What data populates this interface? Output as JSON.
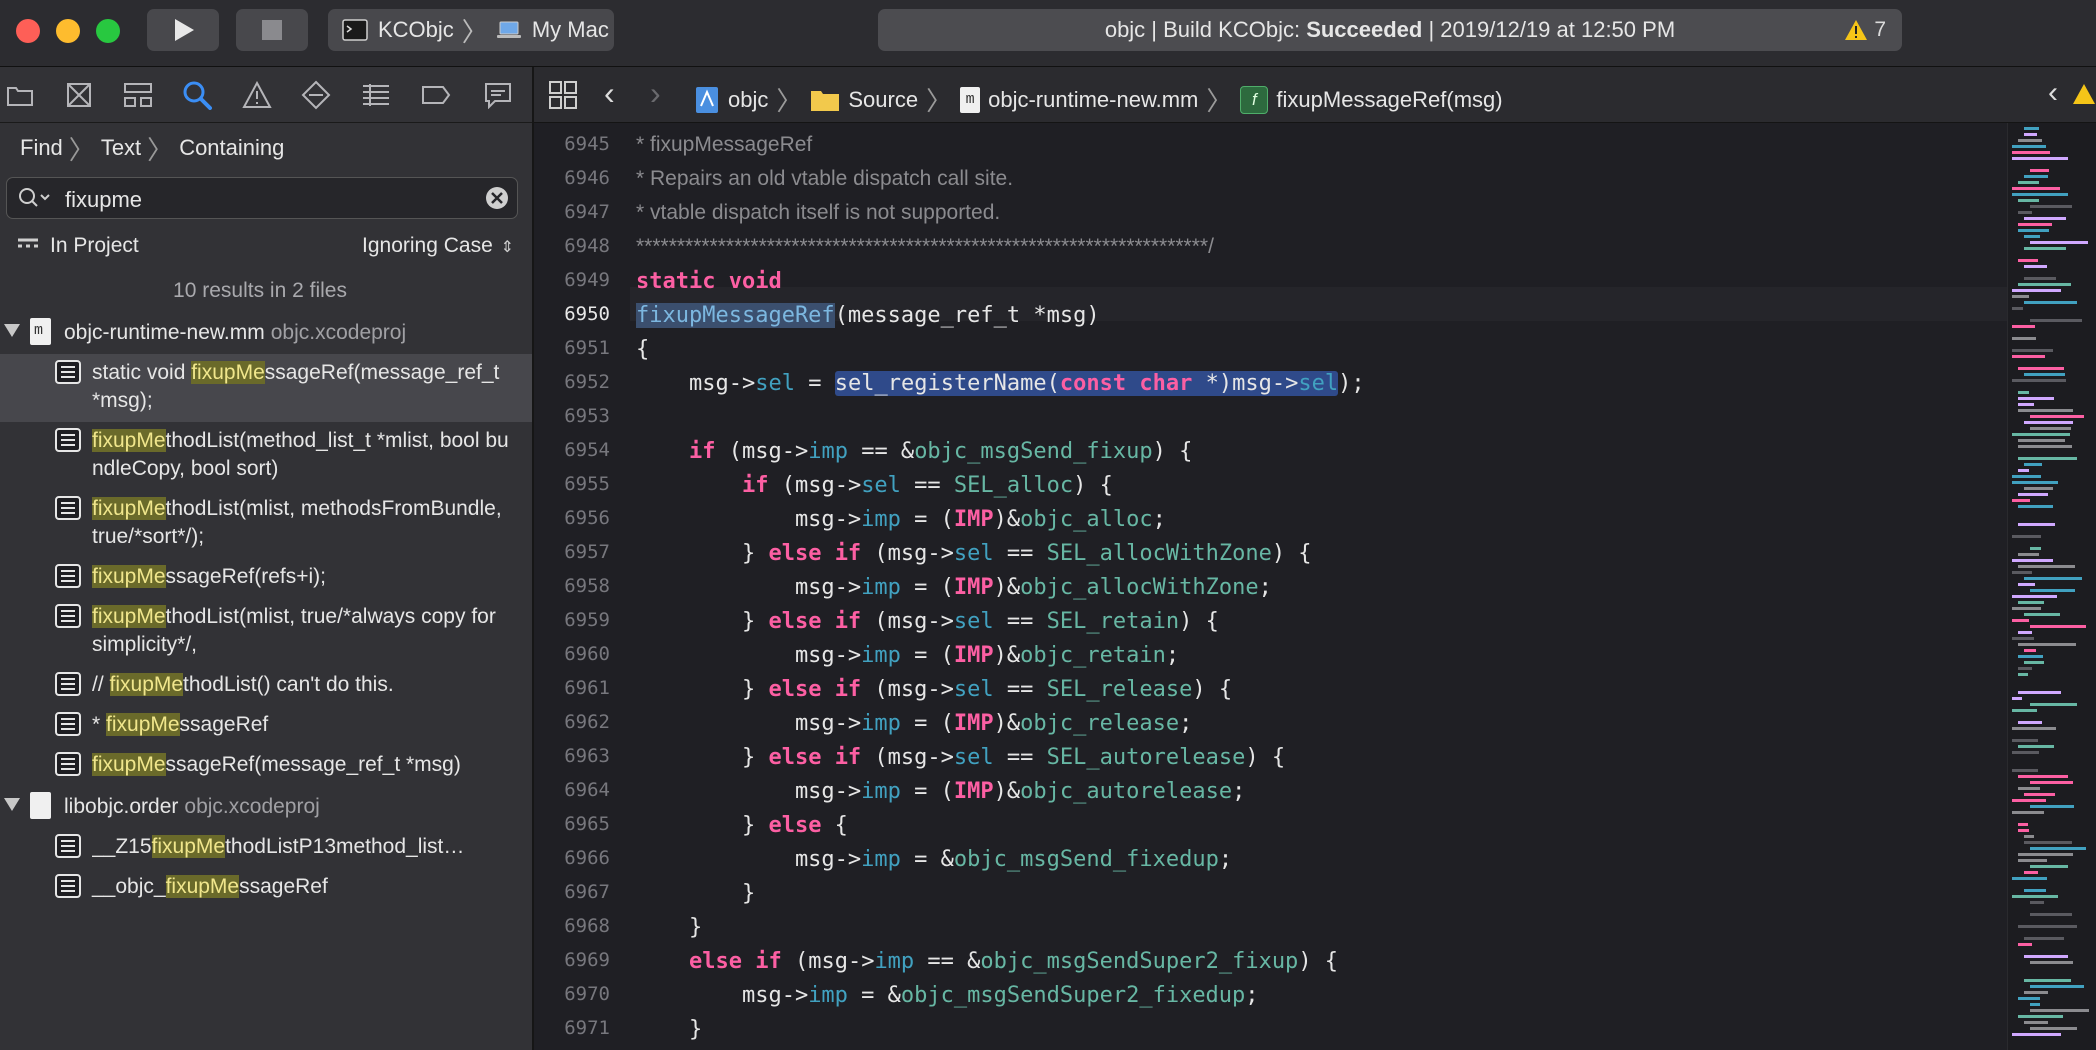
{
  "toolbar": {
    "scheme_target": "KCObjc",
    "scheme_device": "My Mac",
    "status_prefix": "objc | Build KCObjc: ",
    "status_result": "Succeeded",
    "status_suffix": " | 2019/12/19 at 12:50 PM",
    "warning_count": "7"
  },
  "find": {
    "crumb_find": "Find",
    "crumb_text": "Text",
    "crumb_containing": "Containing",
    "query": "fixupme",
    "scope": "In Project",
    "case_mode": "Ignoring Case",
    "results_summary": "10 results in 2 files"
  },
  "results": {
    "file1_name": "objc-runtime-new.mm",
    "file1_project": "objc.xcodeproj",
    "file1_icon": "m",
    "file2_name": "libobjc.order",
    "file2_project": "objc.xcodeproj",
    "r1": {
      "pre": "static void ",
      "hl": "fixupMe",
      "post": "ssageRef(message_ref_t *msg);"
    },
    "r2": {
      "pre": "",
      "hl": "fixupMe",
      "post": "thodList(method_list_t *mlist, bool bundleCopy, bool sort)"
    },
    "r3": {
      "pre": "",
      "hl": "fixupMe",
      "post": "thodList(mlist, methodsFromBundle, true/*sort*/);"
    },
    "r4": {
      "pre": "",
      "hl": "fixupMe",
      "post": "ssageRef(refs+i);"
    },
    "r5": {
      "pre": "",
      "hl": "fixupMe",
      "post": "thodList(mlist, true/*always copy for simplicity*/,"
    },
    "r6": {
      "pre": "// ",
      "hl": "fixupMe",
      "post": "thodList() can't do this."
    },
    "r7": {
      "pre": "* ",
      "hl": "fixupMe",
      "post": "ssageRef"
    },
    "r8": {
      "pre": "",
      "hl": "fixupMe",
      "post": "ssageRef(message_ref_t *msg)"
    },
    "r9": {
      "pre": "__Z15",
      "hl": "fixupMe",
      "post": "thodListP13method_list…"
    },
    "r10": {
      "pre": "__objc_",
      "hl": "fixupMe",
      "post": "ssageRef"
    }
  },
  "jumpbar": {
    "project": "objc",
    "folder": "Source",
    "file": "objc-runtime-new.mm",
    "file_icon": "m",
    "symbol": "fixupMessageRef(msg)",
    "symbol_icon": "f"
  },
  "editor": {
    "current_line": "6950",
    "line_numbers": [
      "6945",
      "6946",
      "6947",
      "6948",
      "6949",
      "6950",
      "6951",
      "6952",
      "6953",
      "6954",
      "6955",
      "6956",
      "6957",
      "6958",
      "6959",
      "6960",
      "6961",
      "6962",
      "6963",
      "6964",
      "6965",
      "6966",
      "6967",
      "6968",
      "6969",
      "6970",
      "6971"
    ],
    "l6945": "* fixupMessageRef",
    "l6946": "* Repairs an old vtable dispatch call site.",
    "l6947": "* vtable dispatch itself is not supported.",
    "l6948": "**********************************************************************/",
    "kw_static": "static",
    "kw_void": "void",
    "fn_name": "fixupMessageRef",
    "l6950_rest": "(message_ref_t *msg)",
    "brace_open": "{",
    "brace_close": "}",
    "msg": "msg",
    "arrow": "->",
    "sel": "sel",
    "imp": "imp",
    "eq_assign": " = ",
    "sel_registerName": "sel_registerName",
    "const": "const",
    "char": "char",
    "cast_tail": " *)msg->",
    "if": "if",
    "else": "else",
    "objc_msgSend_fixup": "objc_msgSend_fixup",
    "SEL_alloc": "SEL_alloc",
    "SEL_allocWithZone": "SEL_allocWithZone",
    "SEL_retain": "SEL_retain",
    "SEL_release": "SEL_release",
    "SEL_autorelease": "SEL_autorelease",
    "IMP": "IMP",
    "objc_alloc": "objc_alloc",
    "objc_allocWithZone": "objc_allocWithZone",
    "objc_retain": "objc_retain",
    "objc_release": "objc_release",
    "objc_autorelease": "objc_autorelease",
    "objc_msgSend_fixedup": "objc_msgSend_fixedup",
    "objc_msgSendSuper2_fixup": "objc_msgSendSuper2_fixup",
    "objc_msgSendSuper2_fixedup": "objc_msgSendSuper2_fixedup"
  },
  "colors": {
    "keyword": "#fc5fa3",
    "function": "#67b7a4",
    "member": "#41a1c0",
    "match_highlight": "#6a6a2a",
    "warning": "#f5c518",
    "search_accent": "#3b8ef5"
  }
}
